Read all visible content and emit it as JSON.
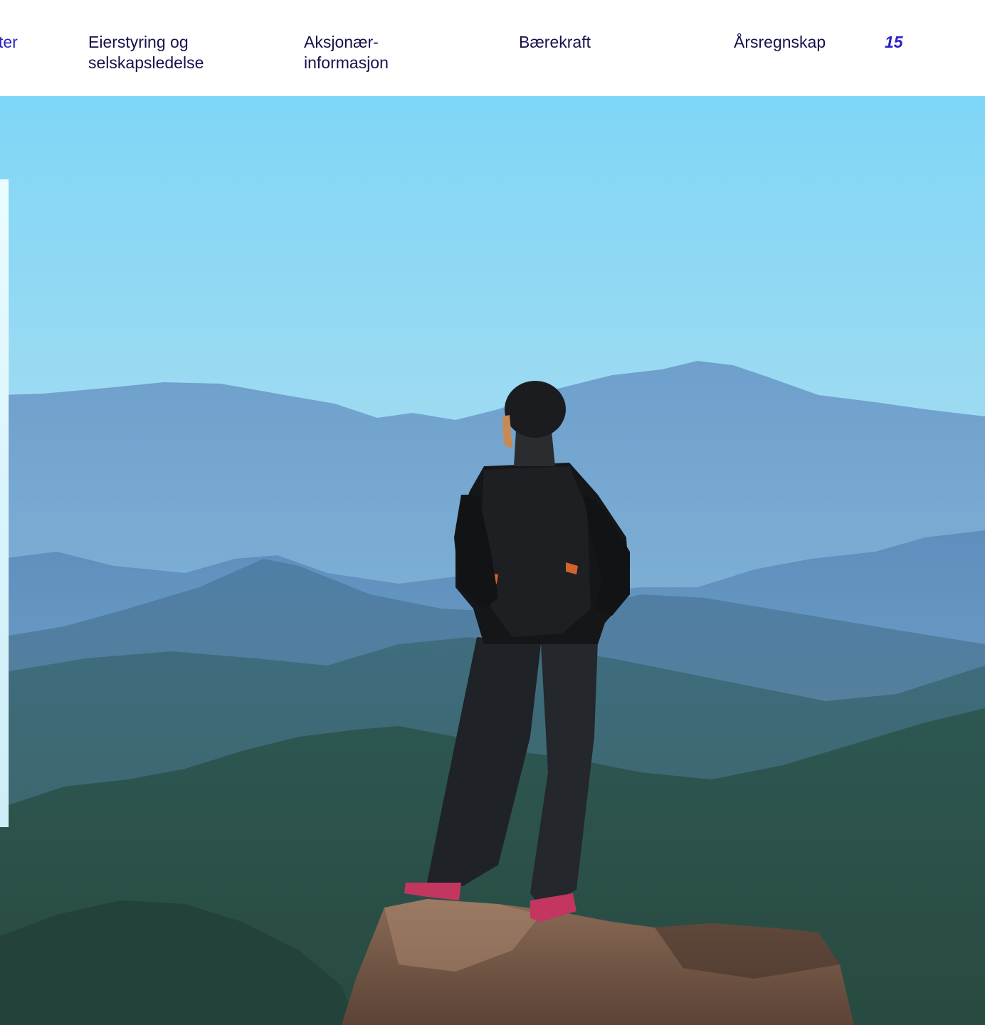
{
  "nav": {
    "partial_item": "ter",
    "items": [
      {
        "line1": "Eierstyring og",
        "line2": "selskapsledelse"
      },
      {
        "line1": "Aksjonær-",
        "line2": "informasjon"
      },
      {
        "line1": "Bærekraft",
        "line2": ""
      },
      {
        "line1": "Årsregnskap",
        "line2": ""
      }
    ],
    "page_number": "15"
  },
  "colors": {
    "nav_text": "#15124a",
    "accent": "#2b22c8",
    "sky_top": "#7fd6f6",
    "sky_bottom": "#b9e4f2"
  }
}
